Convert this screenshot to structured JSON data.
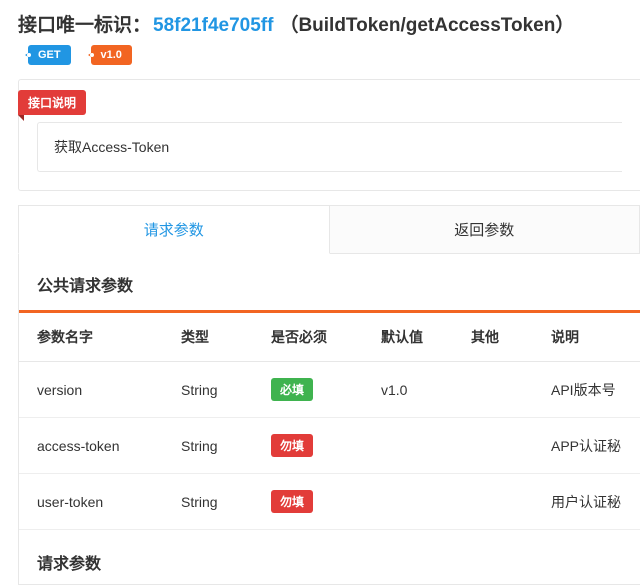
{
  "header": {
    "label": "接口唯一标识：",
    "hash": "58f21f4e705ff",
    "paren": "（BuildToken/getAccessToken）"
  },
  "tags": {
    "method": "GET",
    "version": "v1.0"
  },
  "ribbon": "接口说明",
  "description": "获取Access-Token",
  "tabs": {
    "active": "请求参数",
    "inactive": "返回参数"
  },
  "public_params": {
    "title": "公共请求参数",
    "columns": {
      "name": "参数名字",
      "type": "类型",
      "required": "是否必须",
      "default": "默认值",
      "other": "其他",
      "desc": "说明"
    },
    "rows": [
      {
        "name": "version",
        "type": "String",
        "req_label": "必填",
        "req_kind": "green",
        "default": "v1.0",
        "other": "",
        "desc": "API版本号"
      },
      {
        "name": "access-token",
        "type": "String",
        "req_label": "勿填",
        "req_kind": "red",
        "default": "",
        "other": "",
        "desc": "APP认证秘"
      },
      {
        "name": "user-token",
        "type": "String",
        "req_label": "勿填",
        "req_kind": "red",
        "default": "",
        "other": "",
        "desc": "用户认证秘"
      }
    ]
  },
  "request_params_title": "请求参数"
}
